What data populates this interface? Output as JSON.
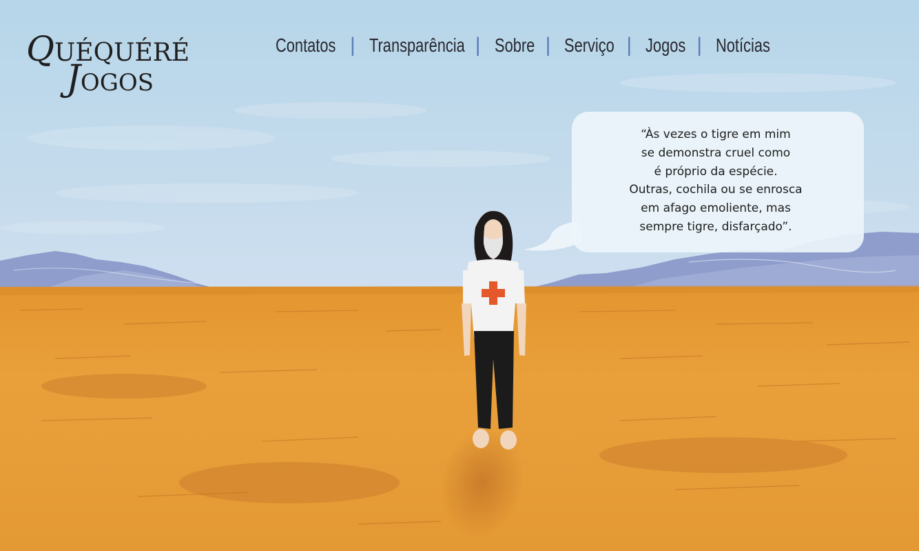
{
  "logo": {
    "line1_cap": "Q",
    "line1_rest": "UÉQUÉRÉ",
    "line2_cap": "J",
    "line2_rest": "OGOS"
  },
  "nav": {
    "items": [
      {
        "label": "Contatos"
      },
      {
        "label": "Transparência"
      },
      {
        "label": "Sobre"
      },
      {
        "label": "Serviço"
      },
      {
        "label": "Jogos"
      },
      {
        "label": "Notícias"
      }
    ],
    "separator": "|"
  },
  "quote": {
    "lines": [
      "“Às vezes o tigre em mim",
      "se demonstra cruel como",
      "é próprio da espécie.",
      "Outras, cochila ou se enrosca",
      "em afago emoliente, mas",
      "sempre tigre, disfarçado”."
    ]
  },
  "colors": {
    "sky_top": "#b9d7ea",
    "sky_bottom": "#c7dcec",
    "mountains": "#8d9ccd",
    "desert": "#e39a36",
    "desert_dark": "#c97a28",
    "nav_text": "#26272e",
    "nav_separator": "#5b7db8",
    "cross": "#e5582a"
  }
}
